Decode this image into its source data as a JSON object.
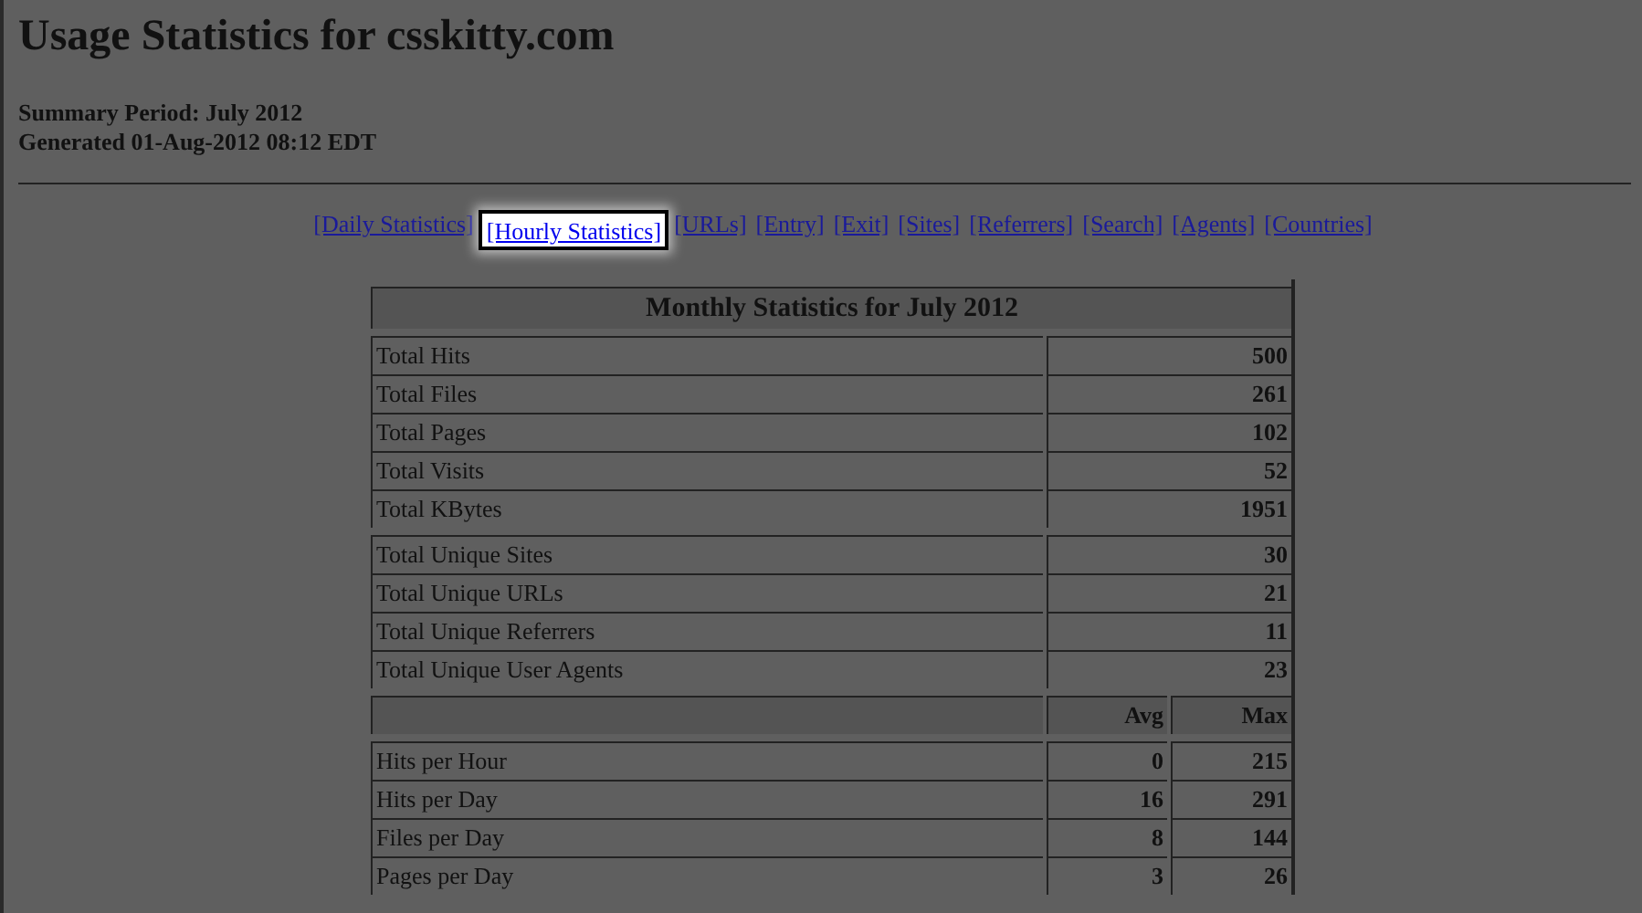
{
  "page": {
    "title": "Usage Statistics for csskitty.com",
    "summary_period": "Summary Period: July 2012",
    "generated": "Generated 01-Aug-2012 08:12 EDT"
  },
  "nav_links": [
    {
      "label": "[Daily Statistics]",
      "selected": false
    },
    {
      "label": "[Hourly Statistics]",
      "selected": true
    },
    {
      "label": "[URLs]",
      "selected": false
    },
    {
      "label": "[Entry]",
      "selected": false
    },
    {
      "label": "[Exit]",
      "selected": false
    },
    {
      "label": "[Sites]",
      "selected": false
    },
    {
      "label": "[Referrers]",
      "selected": false
    },
    {
      "label": "[Search]",
      "selected": false
    },
    {
      "label": "[Agents]",
      "selected": false
    },
    {
      "label": "[Countries]",
      "selected": false
    }
  ],
  "table": {
    "title": "Monthly Statistics for July 2012",
    "groups": [
      {
        "rows": [
          {
            "label": "Total Hits",
            "value": "500"
          },
          {
            "label": "Total Files",
            "value": "261"
          },
          {
            "label": "Total Pages",
            "value": "102"
          },
          {
            "label": "Total Visits",
            "value": "52"
          },
          {
            "label": "Total KBytes",
            "value": "1951"
          }
        ]
      },
      {
        "rows": [
          {
            "label": "Total Unique Sites",
            "value": "30"
          },
          {
            "label": "Total Unique URLs",
            "value": "21"
          },
          {
            "label": "Total Unique Referrers",
            "value": "11"
          },
          {
            "label": "Total Unique User Agents",
            "value": "23"
          }
        ]
      }
    ],
    "rate_columns": [
      "Avg",
      "Max"
    ],
    "rate_rows": [
      {
        "label": "Hits per Hour",
        "avg": "0",
        "max": "215"
      },
      {
        "label": "Hits per Day",
        "avg": "16",
        "max": "291"
      },
      {
        "label": "Files per Day",
        "avg": "8",
        "max": "144"
      },
      {
        "label": "Pages per Day",
        "avg": "3",
        "max": "26"
      }
    ]
  }
}
